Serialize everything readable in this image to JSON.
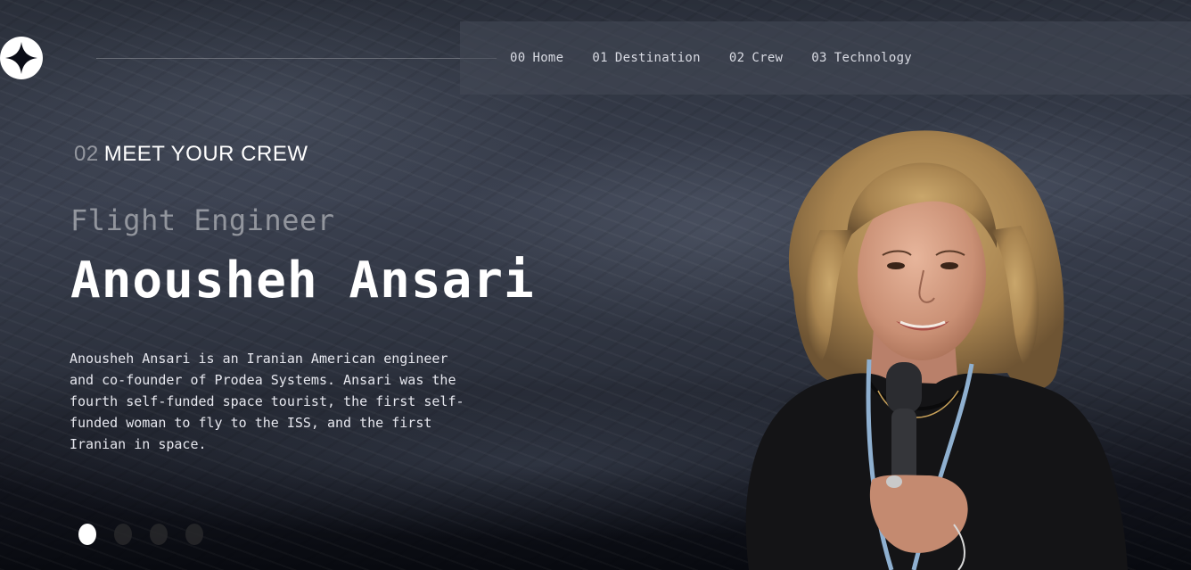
{
  "nav": {
    "items": [
      {
        "num": "00",
        "label": "Home"
      },
      {
        "num": "01",
        "label": "Destination"
      },
      {
        "num": "02",
        "label": "Crew"
      },
      {
        "num": "03",
        "label": "Technology"
      }
    ]
  },
  "page": {
    "eyebrow_num": "02",
    "eyebrow_text": "MEET YOUR CREW"
  },
  "crew": {
    "role": "Flight Engineer",
    "name": "Anousheh Ansari",
    "bio": "Anousheh Ansari is an Iranian American engineer and co-founder of Prodea Systems. Ansari was the fourth self-funded space tourist, the first self-funded woman to fly to the ISS, and the first Iranian in space."
  },
  "carousel": {
    "count": 4,
    "active_index": 0
  },
  "colors": {
    "background": "#0b0d17",
    "text": "#ffffff",
    "muted": "#8b8d96",
    "nav_bg": "#464a58"
  },
  "icons": {
    "logo": "star-logo-icon"
  }
}
